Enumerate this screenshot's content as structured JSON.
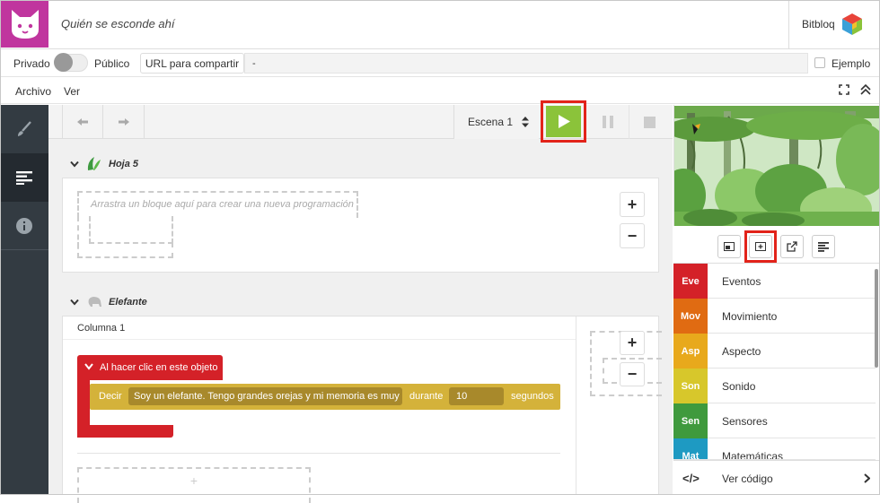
{
  "header": {
    "title": "Quién se esconde ahí",
    "brand": "Bitbloq"
  },
  "share": {
    "private_label": "Privado",
    "public_label": "Público",
    "url_button": "URL para compartir",
    "url_value": "-",
    "example_label": "Ejemplo"
  },
  "menu": {
    "file": "Archivo",
    "view": "Ver"
  },
  "toolbar": {
    "scene": "Escena 1"
  },
  "sheet1": {
    "name": "Hoja 5",
    "drop_hint": "Arrastra un bloque aquí para crear una nueva programación",
    "add": "+",
    "remove": "−"
  },
  "sheet2": {
    "name": "Elefante",
    "column": "Columna 1",
    "event_block": "Al hacer clic en este objeto",
    "say_label": "Decir",
    "say_text": "Soy un elefante. Tengo grandes orejas y mi memoria es muy l",
    "during_label": "durante",
    "during_value": "10",
    "seconds_label": "segundos",
    "add_block": "+",
    "add": "+",
    "remove": "−"
  },
  "categories": [
    {
      "abbr": "Eve",
      "label": "Eventos",
      "color": "#d42128"
    },
    {
      "abbr": "Mov",
      "label": "Movimiento",
      "color": "#e06b12"
    },
    {
      "abbr": "Asp",
      "label": "Aspecto",
      "color": "#e8a91c"
    },
    {
      "abbr": "Son",
      "label": "Sonido",
      "color": "#d7c72b"
    },
    {
      "abbr": "Sen",
      "label": "Sensores",
      "color": "#3f9a3d"
    },
    {
      "abbr": "Mat",
      "label": "Matemáticas",
      "color": "#1e9ac2"
    }
  ],
  "code": {
    "label": "Ver código",
    "icon": "</>"
  },
  "colors": {
    "logo": "#c0359e",
    "play": "#8bc33a",
    "highlight": "#e2231a",
    "event_block": "#d42128",
    "say_block": "#d4b23a"
  }
}
